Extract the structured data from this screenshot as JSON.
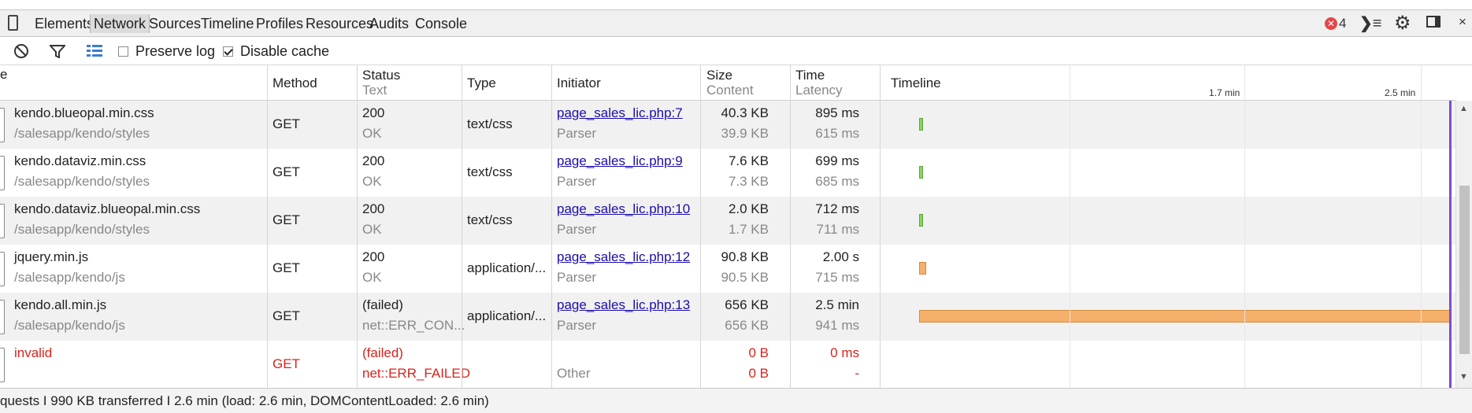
{
  "tabs": [
    "Elements",
    "Network",
    "Sources",
    "Timeline",
    "Profiles",
    "Resources",
    "Audits",
    "Console"
  ],
  "selected_tab": "Network",
  "error_count": "4",
  "toolbar": {
    "preserve_log": "Preserve log",
    "preserve_log_checked": false,
    "disable_cache": "Disable cache",
    "disable_cache_checked": true
  },
  "columns": {
    "name": "e",
    "method": "Method",
    "status": "Status",
    "status_sub": "Text",
    "type": "Type",
    "initiator": "Initiator",
    "size": "Size",
    "size_sub": "Content",
    "time": "Time",
    "time_sub": "Latency",
    "timeline": "Timeline"
  },
  "timeline_ticks": [
    "1.7 min",
    "2.5 min"
  ],
  "rows": [
    {
      "name": "kendo.blueopal.min.css",
      "path": "/salesapp/kendo/styles",
      "method": "GET",
      "status": "200",
      "status_text": "OK",
      "type": "text/css",
      "initiator": "page_sales_lic.php:7",
      "initiator_type": "Parser",
      "size": "40.3 KB",
      "content": "39.9 KB",
      "time": "895 ms",
      "latency": "615 ms",
      "error": false,
      "timeline_fraction": 0.005
    },
    {
      "name": "kendo.dataviz.min.css",
      "path": "/salesapp/kendo/styles",
      "method": "GET",
      "status": "200",
      "status_text": "OK",
      "type": "text/css",
      "initiator": "page_sales_lic.php:9",
      "initiator_type": "Parser",
      "size": "7.6 KB",
      "content": "7.3 KB",
      "time": "699 ms",
      "latency": "685 ms",
      "error": false,
      "timeline_fraction": 0.005
    },
    {
      "name": "kendo.dataviz.blueopal.min.css",
      "path": "/salesapp/kendo/styles",
      "method": "GET",
      "status": "200",
      "status_text": "OK",
      "type": "text/css",
      "initiator": "page_sales_lic.php:10",
      "initiator_type": "Parser",
      "size": "2.0 KB",
      "content": "1.7 KB",
      "time": "712 ms",
      "latency": "711 ms",
      "error": false,
      "timeline_fraction": 0.005
    },
    {
      "name": "jquery.min.js",
      "path": "/salesapp/kendo/js",
      "method": "GET",
      "status": "200",
      "status_text": "OK",
      "type": "application/...",
      "initiator": "page_sales_lic.php:12",
      "initiator_type": "Parser",
      "size": "90.8 KB",
      "content": "90.5 KB",
      "time": "2.00 s",
      "latency": "715 ms",
      "error": false,
      "timeline_fraction": 0.013
    },
    {
      "name": "kendo.all.min.js",
      "path": "/salesapp/kendo/js",
      "method": "GET",
      "status": "(failed)",
      "status_text": "net::ERR_CON...",
      "type": "application/...",
      "initiator": "page_sales_lic.php:13",
      "initiator_type": "Parser",
      "size": "656 KB",
      "content": "656 KB",
      "time": "2.5 min",
      "latency": "941 ms",
      "error": false,
      "timeline_fraction": 1.0
    },
    {
      "name": "invalid",
      "path": "",
      "method": "GET",
      "status": "(failed)",
      "status_text": "net::ERR_FAILED",
      "type": "",
      "initiator": "",
      "initiator_type": "Other",
      "size": "0 B",
      "content": "0 B",
      "time": "0 ms",
      "latency": "-",
      "error": true,
      "timeline_fraction": 0
    }
  ],
  "status_bar": "quests I 990 KB transferred I 2.6 min (load: 2.6 min, DOMContentLoaded: 2.6 min)",
  "colors": {
    "error": "#d9231c",
    "link": "#1a0dab",
    "bar_green": "#8fd16a",
    "bar_orange": "#f5b06b",
    "dom_content_line": "#7d4bd1"
  }
}
